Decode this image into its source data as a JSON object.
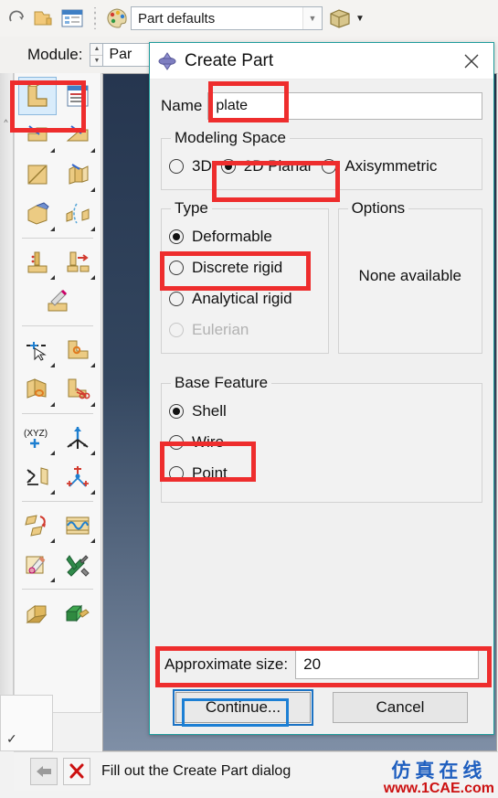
{
  "toolbar": {
    "icons": [
      "redo-icon",
      "open-database-icon",
      "model-tree-icon",
      "color-palette-icon"
    ],
    "render_style_combo": {
      "value": "Part defaults",
      "caret": "chevron-down-icon"
    },
    "view_cube_button": {
      "icon": "view-cube-icon",
      "caret": "chevron-down-icon"
    }
  },
  "module_bar": {
    "label": "Module:",
    "value": "Par",
    "spinner_up": "spin-up-icon",
    "spinner_down": "spin-down-icon"
  },
  "toolbox": {
    "rows": [
      [
        "create-part-icon",
        "create-part-from-mesh-icon"
      ],
      [
        "partition-cell-icon",
        "partition-face-icon"
      ],
      [
        "create-shell-icon",
        "create-solid-sweep-icon"
      ],
      [
        "create-cut-extrude-icon",
        "create-revolve-icon"
      ],
      [
        "create-datum-point-icon",
        "create-blend-icon"
      ],
      [
        "edit-feature-icon"
      ],
      [
        "create-wire-point-icon",
        "create-round-fillet-icon"
      ],
      [
        "create-chamfer-icon",
        "create-cut-circular-icon"
      ],
      [
        "datum-csys-icon",
        "datum-axis-icon"
      ],
      [
        "datum-plane-icon",
        "datum-point-array-icon"
      ],
      [
        "mirror-pattern-icon",
        "sketch-edit-icon"
      ],
      [
        "delete-feature-icon",
        "tools-icon"
      ],
      [
        "merge-cut-icon",
        "copy-part-icon"
      ]
    ],
    "selected": "create-part-icon"
  },
  "dialog": {
    "icon": "abaqus-diamond-icon",
    "title": "Create Part",
    "close_icon": "close-icon",
    "name": {
      "label": "Name",
      "value": "plate",
      "placeholder": ""
    },
    "modeling_space": {
      "legend": "Modeling Space",
      "options": [
        {
          "label": "3D",
          "selected": false
        },
        {
          "label": "2D Planar",
          "selected": true
        },
        {
          "label": "Axisymmetric",
          "selected": false
        }
      ]
    },
    "type": {
      "legend": "Type",
      "options": [
        {
          "label": "Deformable",
          "selected": true,
          "disabled": false
        },
        {
          "label": "Discrete rigid",
          "selected": false,
          "disabled": false
        },
        {
          "label": "Analytical rigid",
          "selected": false,
          "disabled": false
        },
        {
          "label": "Eulerian",
          "selected": false,
          "disabled": true
        }
      ]
    },
    "options": {
      "legend": "Options",
      "text": "None available"
    },
    "base_feature": {
      "legend": "Base Feature",
      "options": [
        {
          "label": "Shell",
          "selected": true
        },
        {
          "label": "Wire",
          "selected": false
        },
        {
          "label": "Point",
          "selected": false
        }
      ]
    },
    "approximate_size": {
      "label": "Approximate size:",
      "value": "20"
    },
    "buttons": {
      "continue_label": "Continue...",
      "cancel_label": "Cancel"
    }
  },
  "prompt_bar": {
    "back_icon": "back-arrow-icon",
    "cancel_icon": "red-x-icon",
    "text": "Fill out the Create Part dialog"
  },
  "watermark": {
    "center": "1CAE.COM",
    "logo_cn": "仿真在线",
    "logo_url": "www.1CAE.com"
  },
  "colors": {
    "highlight": "#ee2d2d",
    "focus": "#1c7fd4",
    "dialog_border": "#1f9c9c",
    "selection": "#d9ecfb",
    "viewport_top": "#26364f",
    "viewport_bottom": "#7f8fa6"
  }
}
